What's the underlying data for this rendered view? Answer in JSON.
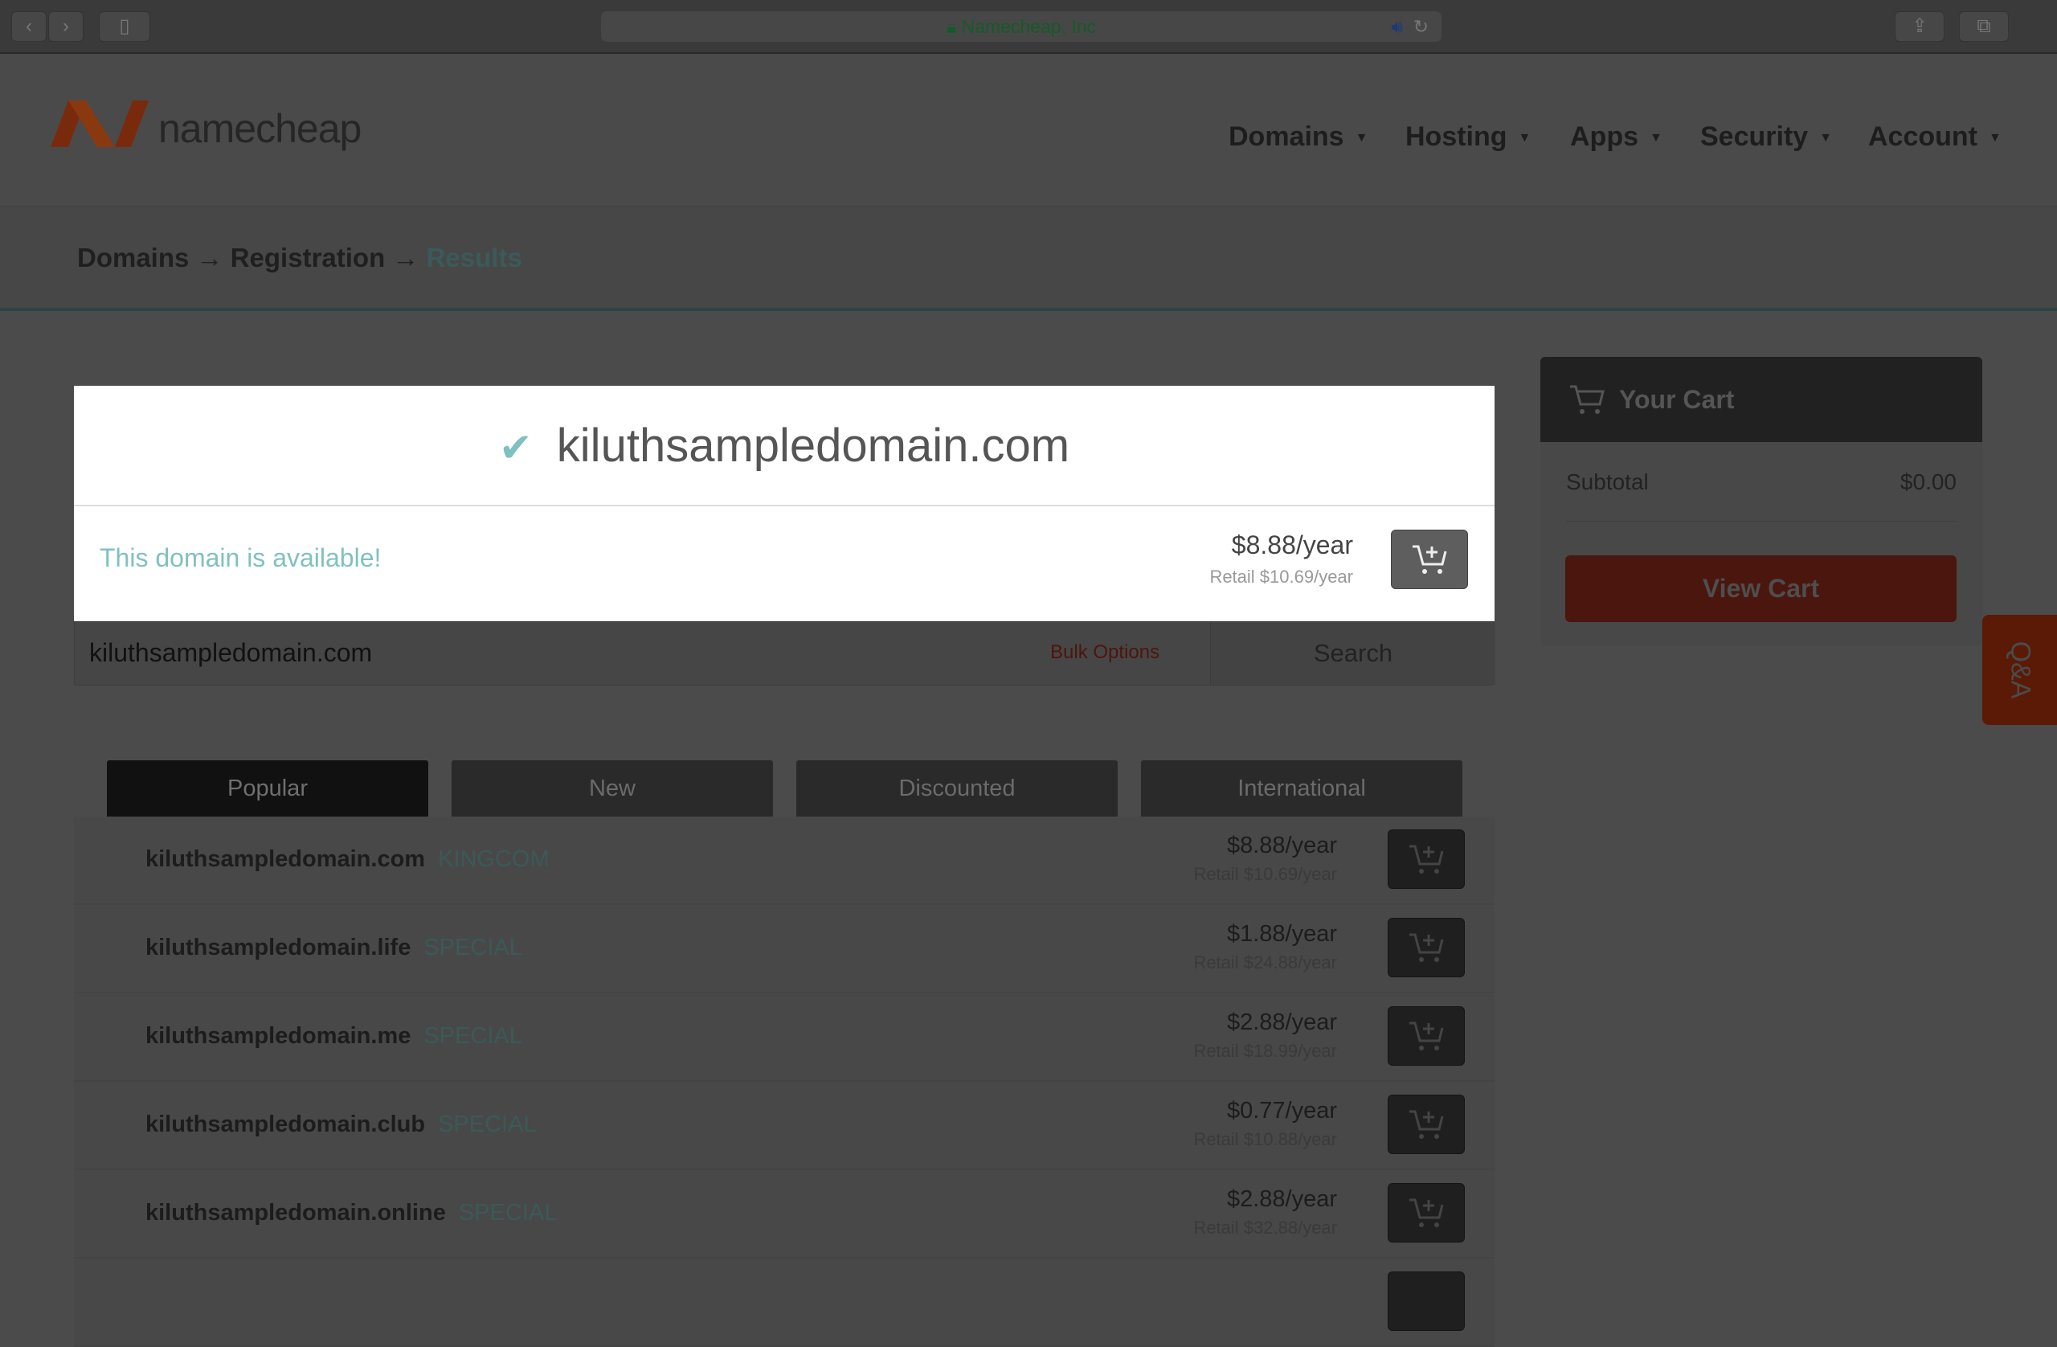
{
  "browser": {
    "site_label": "Namecheap, Inc"
  },
  "header": {
    "brand": "namecheap",
    "nav": [
      "Domains",
      "Hosting",
      "Apps",
      "Security",
      "Account"
    ]
  },
  "breadcrumb": {
    "items": [
      "Domains",
      "Registration"
    ],
    "separator": "→",
    "current": "Results"
  },
  "result": {
    "domain": "kiluthsampledomain.com",
    "status": "This domain is available!",
    "price": "$8.88/year",
    "retail": "Retail $10.69/year"
  },
  "search": {
    "value": "kiluthsampledomain.com",
    "bulk_label": "Bulk Options",
    "button_label": "Search"
  },
  "tabs": [
    {
      "label": "Popular",
      "active": true
    },
    {
      "label": "New"
    },
    {
      "label": "Discounted"
    },
    {
      "label": "International"
    }
  ],
  "rows": [
    {
      "domain": "kiluthsampledomain.com",
      "tag": "KINGCOM",
      "price": "$8.88/year",
      "retail": "Retail $10.69/year"
    },
    {
      "domain": "kiluthsampledomain.life",
      "tag": "SPECIAL",
      "price": "$1.88/year",
      "retail": "Retail $24.88/year"
    },
    {
      "domain": "kiluthsampledomain.me",
      "tag": "SPECIAL",
      "price": "$2.88/year",
      "retail": "Retail $18.99/year"
    },
    {
      "domain": "kiluthsampledomain.club",
      "tag": "SPECIAL",
      "price": "$0.77/year",
      "retail": "Retail $10.88/year"
    },
    {
      "domain": "kiluthsampledomain.online",
      "tag": "SPECIAL",
      "price": "$2.88/year",
      "retail": "Retail $32.88/year"
    }
  ],
  "cart": {
    "title": "Your Cart",
    "subtotal_label": "Subtotal",
    "subtotal": "$0.00",
    "view_cart": "View Cart"
  },
  "qa": {
    "label": "Q&A"
  },
  "colors": {
    "accent_teal": "#80c1c0",
    "brand_orange": "#d4541a",
    "view_cart_red": "#4a160d"
  }
}
